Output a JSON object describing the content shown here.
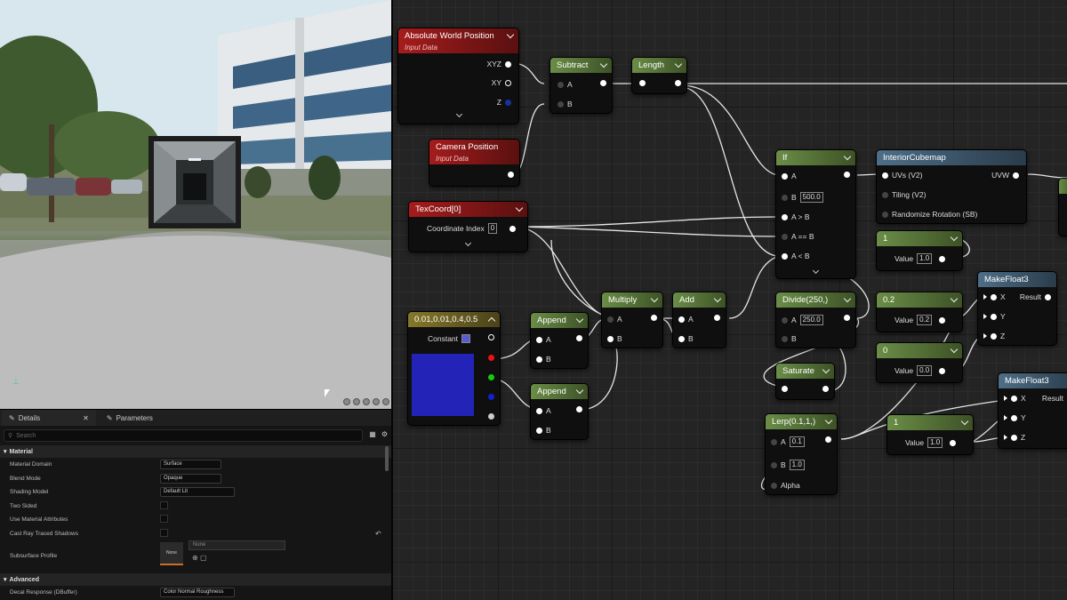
{
  "details": {
    "tabs": [
      {
        "label": "Details"
      },
      {
        "label": "Parameters"
      }
    ],
    "search_placeholder": "Search",
    "section_material": "Material",
    "section_advanced": "Advanced",
    "props": {
      "material_domain": {
        "label": "Material Domain",
        "value": "Surface"
      },
      "blend_mode": {
        "label": "Blend Mode",
        "value": "Opaque"
      },
      "shading_model": {
        "label": "Shading Model",
        "value": "Default Lit"
      },
      "two_sided": {
        "label": "Two Sided"
      },
      "use_material_attributes": {
        "label": "Use Material Attributes"
      },
      "cast_ray_traced_shadows": {
        "label": "Cast Ray Traced Shadows"
      },
      "subsurface_profile": {
        "label": "Subsurface Profile",
        "button": "None",
        "dropdown": "None"
      },
      "decal_response": {
        "label": "Decal Response (DBuffer)",
        "value": "Color Normal Roughness"
      }
    }
  },
  "nodes": {
    "abs_world_pos": {
      "title": "Absolute World Position",
      "subtitle": "Input Data",
      "pins": [
        "XYZ",
        "XY",
        "Z"
      ]
    },
    "camera_pos": {
      "title": "Camera Position",
      "subtitle": "Input Data"
    },
    "texcoord": {
      "title": "TexCoord[0]",
      "pin": "Coordinate Index",
      "value": "0"
    },
    "subtract": {
      "title": "Subtract",
      "a": "A",
      "b": "B"
    },
    "length": {
      "title": "Length"
    },
    "if": {
      "title": "If",
      "a": "A",
      "b": "B",
      "b_value": "500.0",
      "agb": "A > B",
      "aeb": "A == B",
      "alb": "A < B"
    },
    "interior": {
      "title": "InteriorCubemap",
      "uvs": "UVs (V2)",
      "tiling": "Tiling (V2)",
      "rand": "Randomize Rotation (SB)",
      "out": "UVW"
    },
    "const1": {
      "title": "1",
      "pin": "Value",
      "value": "1.0"
    },
    "const02": {
      "title": "0.2",
      "pin": "Value",
      "value": "0.2"
    },
    "const0": {
      "title": "0",
      "pin": "Value",
      "value": "0.0"
    },
    "const1b": {
      "title": "1",
      "pin": "Value",
      "value": "1.0"
    },
    "makefloat3_a": {
      "title": "MakeFloat3",
      "x": "X",
      "y": "Y",
      "z": "Z",
      "out": "Result"
    },
    "makefloat3_b": {
      "title": "MakeFloat3",
      "x": "X",
      "y": "Y",
      "z": "Z",
      "out": "Result"
    },
    "vector": {
      "title": "0.01,0.01,0.4,0.5",
      "pin": "Constant",
      "color": "#2323b8"
    },
    "append1": {
      "title": "Append",
      "a": "A",
      "b": "B"
    },
    "append2": {
      "title": "Append",
      "a": "A",
      "b": "B"
    },
    "multiply": {
      "title": "Multiply",
      "a": "A",
      "b": "B"
    },
    "add": {
      "title": "Add",
      "a": "A",
      "b": "B"
    },
    "divide": {
      "title": "Divide(250,)",
      "a": "A",
      "a_value": "250.0",
      "b": "B"
    },
    "saturate": {
      "title": "Saturate"
    },
    "lerp": {
      "title": "Lerp(0.1,1,)",
      "a": "A",
      "a_value": "0.1",
      "b": "B",
      "b_value": "1.0",
      "alpha": "Alpha"
    }
  },
  "colors": {
    "input_node": "#a51c1c",
    "math_node": "#6a8d47",
    "vector_node": "#85782a",
    "function_node": "#4e6e88"
  }
}
